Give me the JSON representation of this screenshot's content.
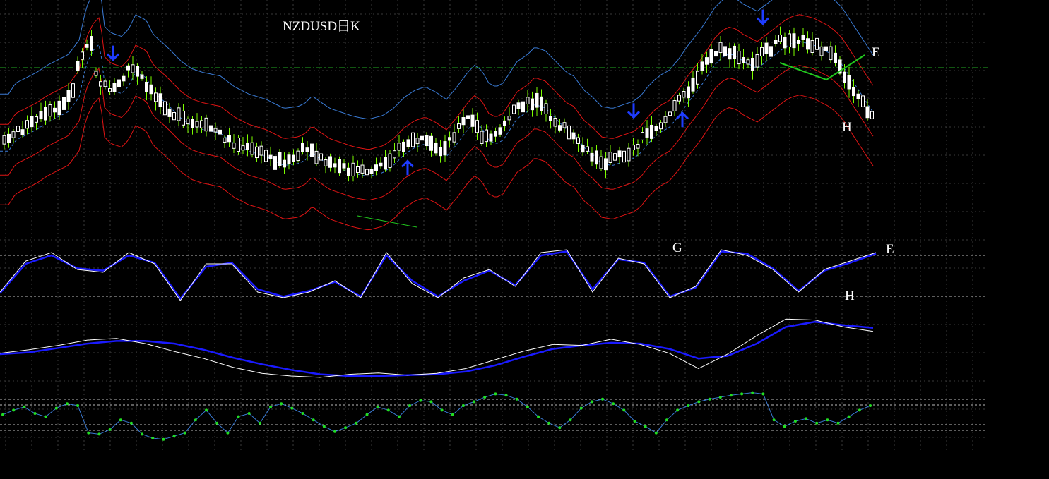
{
  "chart_data": {
    "type": "candlestick",
    "title": "NZDUSD日K",
    "timeframe": "日K",
    "grid": true,
    "colors": {
      "background": "#000000",
      "grid": "#3a3a3a",
      "candle": "#ffffff",
      "wick": "#7cfc00",
      "outer_band": "#3a7bd5",
      "inner_band": "#e01414",
      "middle_band": "#3a7bd5",
      "arrow": "#1e3cff",
      "trendline": "#22c81e",
      "reference_line": "#22aa22",
      "fast_line": "#ffffff",
      "slow_line": "#1a1aff",
      "indicator_line": "#3a7bd5",
      "indicator_dot": "#22dd22"
    },
    "price_panel": {
      "close_points": [
        [
          0,
          36
        ],
        [
          10,
          42
        ],
        [
          25,
          45
        ],
        [
          40,
          48
        ],
        [
          55,
          52
        ],
        [
          70,
          55
        ],
        [
          85,
          58
        ],
        [
          100,
          66
        ],
        [
          110,
          84
        ],
        [
          120,
          92
        ],
        [
          130,
          96
        ],
        [
          135,
          74
        ],
        [
          145,
          70
        ],
        [
          160,
          68
        ],
        [
          170,
          72
        ],
        [
          180,
          80
        ],
        [
          195,
          77
        ],
        [
          205,
          69
        ],
        [
          225,
          62
        ],
        [
          245,
          54
        ],
        [
          260,
          50
        ],
        [
          275,
          48
        ],
        [
          300,
          46
        ],
        [
          320,
          40
        ],
        [
          340,
          36
        ],
        [
          365,
          33
        ],
        [
          390,
          28
        ],
        [
          410,
          29
        ],
        [
          420,
          31
        ],
        [
          430,
          35
        ],
        [
          440,
          32
        ],
        [
          455,
          28
        ],
        [
          470,
          26
        ],
        [
          485,
          24
        ],
        [
          495,
          23
        ],
        [
          510,
          22
        ],
        [
          530,
          24
        ],
        [
          545,
          28
        ],
        [
          560,
          34
        ],
        [
          575,
          38
        ],
        [
          590,
          40
        ],
        [
          605,
          37
        ],
        [
          620,
          33
        ],
        [
          635,
          40
        ],
        [
          650,
          48
        ],
        [
          660,
          52
        ],
        [
          670,
          49
        ],
        [
          680,
          42
        ],
        [
          690,
          40
        ],
        [
          700,
          42
        ],
        [
          710,
          48
        ],
        [
          720,
          54
        ],
        [
          735,
          58
        ],
        [
          745,
          62
        ],
        [
          760,
          60
        ],
        [
          775,
          54
        ],
        [
          790,
          48
        ],
        [
          800,
          46
        ],
        [
          815,
          38
        ],
        [
          825,
          35
        ],
        [
          840,
          29
        ],
        [
          855,
          28
        ],
        [
          870,
          30
        ],
        [
          885,
          32
        ],
        [
          895,
          35
        ],
        [
          905,
          40
        ],
        [
          915,
          44
        ],
        [
          925,
          47
        ],
        [
          935,
          49
        ],
        [
          950,
          56
        ],
        [
          960,
          62
        ],
        [
          970,
          67
        ],
        [
          980,
          72
        ],
        [
          990,
          78
        ],
        [
          1000,
          84
        ],
        [
          1010,
          88
        ],
        [
          1020,
          90
        ],
        [
          1030,
          89
        ],
        [
          1040,
          86
        ],
        [
          1050,
          84
        ],
        [
          1060,
          82
        ],
        [
          1070,
          85
        ],
        [
          1080,
          88
        ],
        [
          1090,
          91
        ],
        [
          1100,
          94
        ],
        [
          1110,
          96
        ],
        [
          1120,
          97
        ],
        [
          1130,
          96
        ],
        [
          1140,
          95
        ],
        [
          1150,
          93
        ],
        [
          1160,
          91
        ],
        [
          1170,
          88
        ],
        [
          1180,
          84
        ],
        [
          1190,
          78
        ],
        [
          1200,
          72
        ],
        [
          1210,
          66
        ],
        [
          1220,
          60
        ],
        [
          1230,
          54
        ],
        [
          1238,
          50
        ]
      ],
      "markers": [
        {
          "type": "down-arrow",
          "x": 160
        },
        {
          "type": "down-arrow",
          "x": 1080
        },
        {
          "type": "down-arrow",
          "x": 897
        },
        {
          "type": "up-arrow",
          "x": 577
        },
        {
          "type": "up-arrow",
          "x": 966
        }
      ]
    },
    "stochastic_panel": {
      "series": [
        {
          "values": [
            20,
            75,
            90,
            60,
            55,
            90,
            70,
            5,
            70,
            70,
            20,
            10,
            20,
            40,
            10,
            90,
            35,
            10,
            45,
            60,
            30,
            90,
            95,
            20,
            80,
            70,
            10,
            30,
            95,
            85,
            60,
            20,
            60,
            75,
            90
          ]
        },
        {
          "values": [
            18,
            70,
            85,
            62,
            58,
            85,
            72,
            8,
            65,
            72,
            25,
            12,
            22,
            38,
            12,
            85,
            40,
            12,
            40,
            58,
            32,
            85,
            92,
            25,
            78,
            72,
            12,
            28,
            92,
            88,
            62,
            22,
            58,
            72,
            88
          ]
        }
      ]
    },
    "macd_panel": {
      "series": [
        {
          "values": [
            40,
            48,
            58,
            70,
            74,
            62,
            44,
            28,
            8,
            -6,
            -12,
            -15,
            -8,
            -5,
            -10,
            -6,
            5,
            25,
            45,
            60,
            58,
            72,
            60,
            40,
            5,
            38,
            80,
            118,
            116,
            100,
            90
          ]
        },
        {
          "values": [
            38,
            42,
            52,
            62,
            68,
            68,
            62,
            48,
            30,
            15,
            2,
            -8,
            -12,
            -12,
            -10,
            -8,
            -2,
            12,
            32,
            50,
            58,
            64,
            62,
            50,
            28,
            34,
            62,
            100,
            112,
            104,
            98
          ]
        }
      ]
    },
    "indicator_panel": {
      "values": [
        48,
        55,
        60,
        50,
        45,
        58,
        65,
        62,
        20,
        18,
        25,
        40,
        35,
        18,
        12,
        10,
        15,
        20,
        40,
        55,
        35,
        20,
        45,
        50,
        35,
        60,
        65,
        58,
        50,
        40,
        30,
        22,
        28,
        35,
        48,
        60,
        55,
        45,
        62,
        70,
        68,
        55,
        48,
        62,
        68,
        75,
        80,
        78,
        72,
        60,
        45,
        35,
        28,
        40,
        58,
        68,
        72,
        65,
        55,
        38,
        30,
        20,
        40,
        55,
        62,
        68,
        72,
        75,
        78,
        80,
        82,
        80,
        40,
        30,
        38,
        42,
        35,
        40,
        35,
        45,
        55,
        62
      ]
    },
    "annotations": [
      "E",
      "H",
      "G",
      "E",
      "H"
    ]
  }
}
